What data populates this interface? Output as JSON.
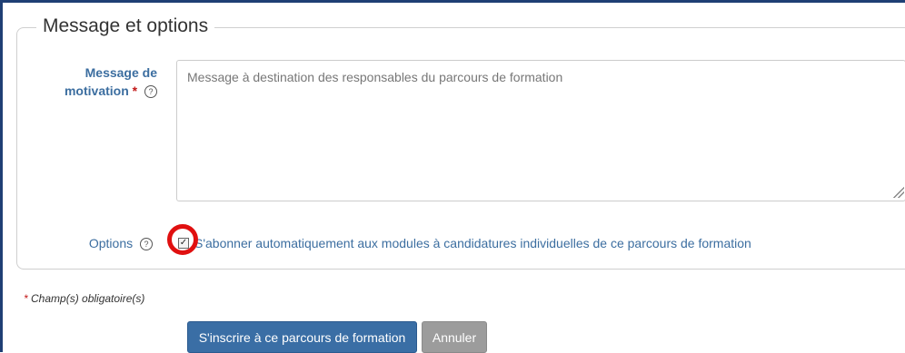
{
  "section": {
    "legend": "Message et options"
  },
  "message": {
    "label_line1": "Message de",
    "label_line2": "motivation",
    "required_marker": "*",
    "placeholder": "Message à destination des responsables du parcours de formation",
    "value": ""
  },
  "options": {
    "label": "Options",
    "checkbox_checked": true,
    "checkbox_label": "S'abonner automatiquement aux modules à candidatures individuelles de ce parcours de formation"
  },
  "help_icon_glyph": "?",
  "required_note": {
    "marker": "*",
    "text": "Champ(s) obligatoire(s)"
  },
  "buttons": {
    "submit_label": "S'inscrire à ce parcours de formation",
    "cancel_label": "Annuler"
  },
  "colors": {
    "accent": "#3a6ea5",
    "label": "#3c6ea0",
    "required": "#c21818",
    "highlight_circle": "#e01010",
    "cancel": "#9c9c9c"
  }
}
